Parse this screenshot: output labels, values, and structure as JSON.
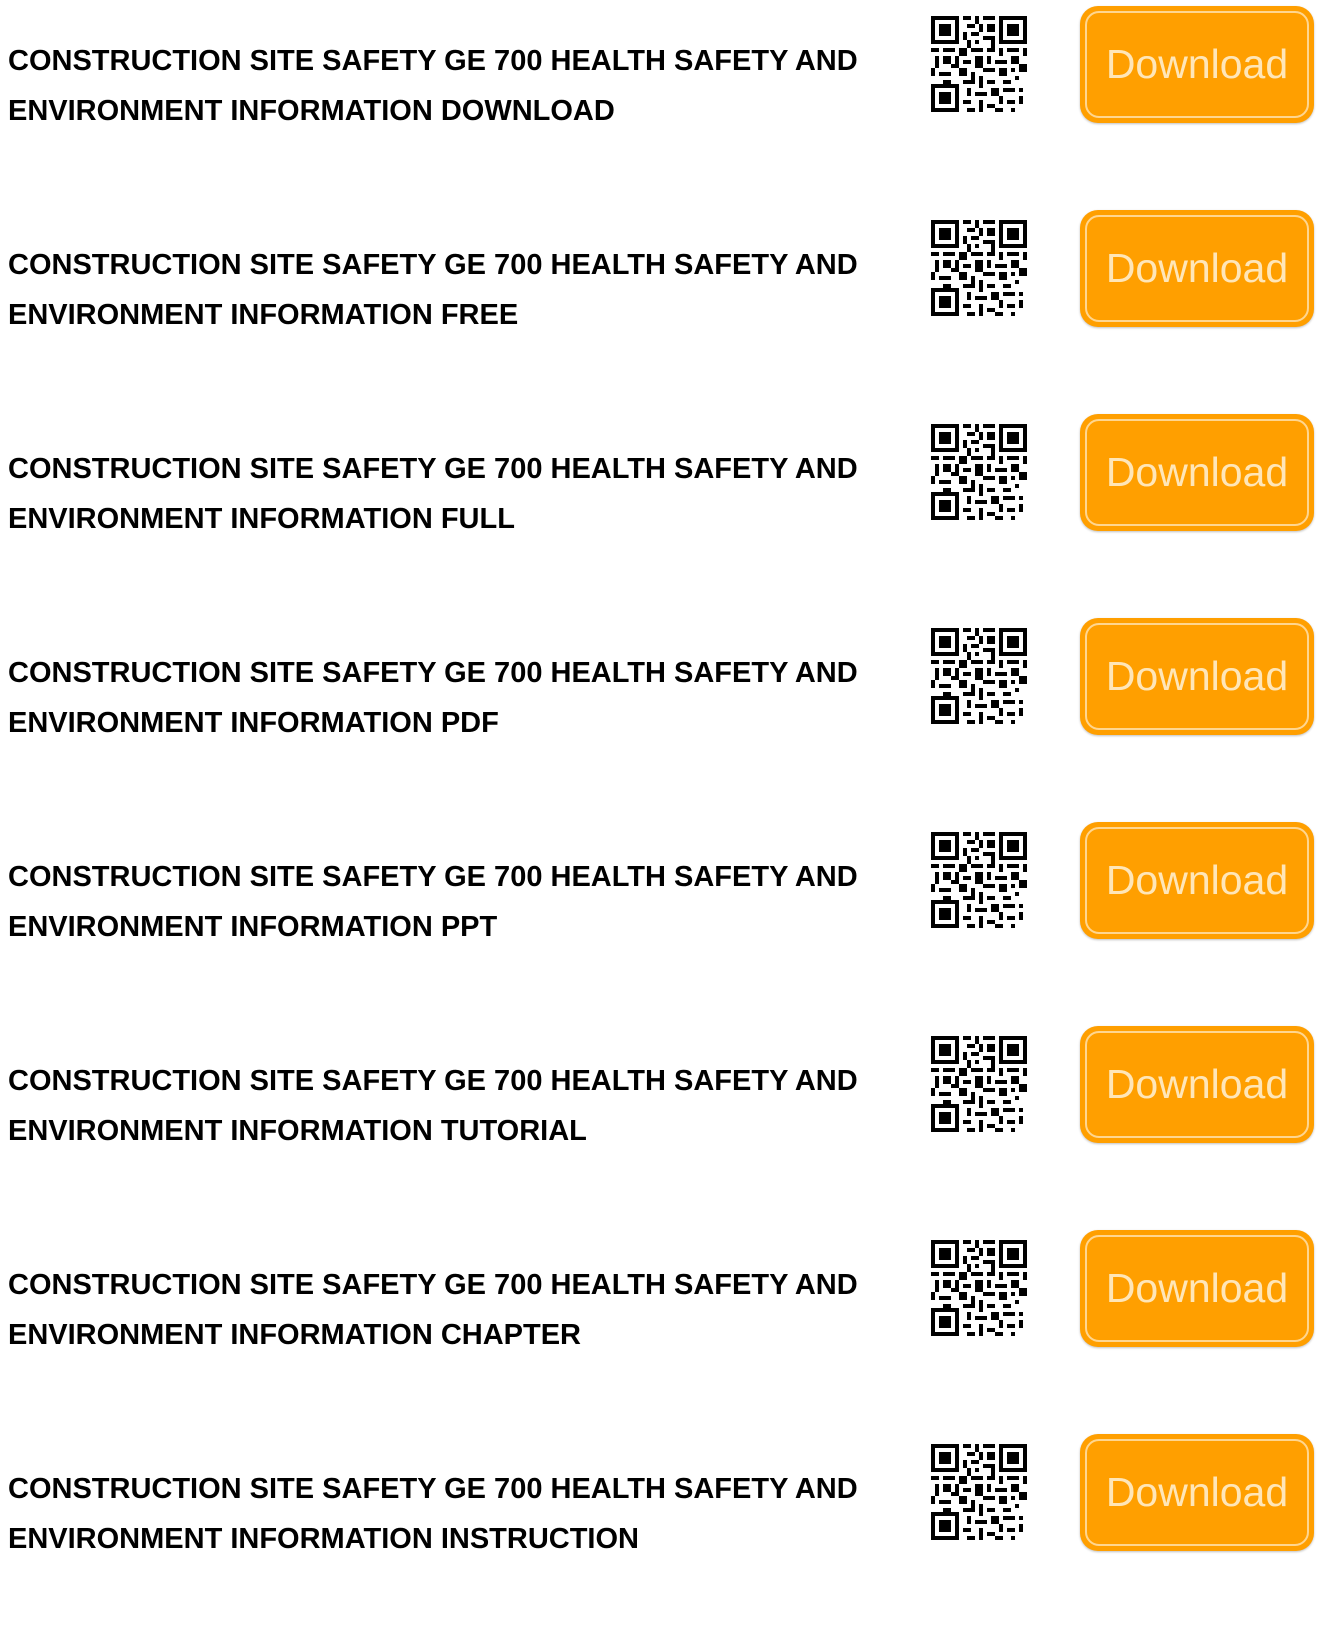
{
  "items": [
    {
      "title": "CONSTRUCTION SITE SAFETY GE 700 HEALTH SAFETY AND ENVIRONMENT INFORMATION DOWNLOAD",
      "button_label": "Download",
      "icon": "qr-code-icon"
    },
    {
      "title": "CONSTRUCTION SITE SAFETY GE 700 HEALTH SAFETY AND ENVIRONMENT INFORMATION FREE",
      "button_label": "Download",
      "icon": "qr-code-icon"
    },
    {
      "title": "CONSTRUCTION SITE SAFETY GE 700 HEALTH SAFETY AND ENVIRONMENT INFORMATION FULL",
      "button_label": "Download",
      "icon": "qr-code-icon"
    },
    {
      "title": "CONSTRUCTION SITE SAFETY GE 700 HEALTH SAFETY AND ENVIRONMENT INFORMATION PDF",
      "button_label": "Download",
      "icon": "qr-code-icon"
    },
    {
      "title": "CONSTRUCTION SITE SAFETY GE 700 HEALTH SAFETY AND ENVIRONMENT INFORMATION PPT",
      "button_label": "Download",
      "icon": "qr-code-icon"
    },
    {
      "title": "CONSTRUCTION SITE SAFETY GE 700 HEALTH SAFETY AND ENVIRONMENT INFORMATION TUTORIAL",
      "button_label": "Download",
      "icon": "qr-code-icon"
    },
    {
      "title": "CONSTRUCTION SITE SAFETY GE 700 HEALTH SAFETY AND ENVIRONMENT INFORMATION CHAPTER",
      "button_label": "Download",
      "icon": "qr-code-icon"
    },
    {
      "title": "CONSTRUCTION SITE SAFETY GE 700 HEALTH SAFETY AND ENVIRONMENT INFORMATION INSTRUCTION",
      "button_label": "Download",
      "icon": "qr-code-icon"
    }
  ],
  "colors": {
    "button_bg": "#ff9f00",
    "button_text": "#ffe6b8",
    "title_text": "#000000"
  }
}
